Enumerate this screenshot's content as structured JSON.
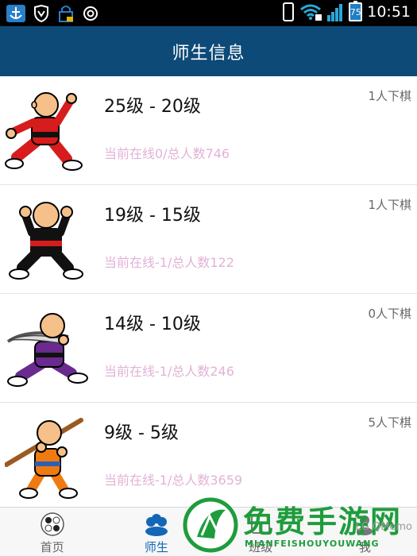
{
  "status_bar": {
    "time": "10:51",
    "battery": "75",
    "icons": [
      "anchor-icon",
      "shield-icon",
      "lock-box-icon",
      "target-icon",
      "phone-icon",
      "wifi-icon",
      "signal-icon",
      "battery-icon"
    ]
  },
  "header": {
    "title": "师生信息"
  },
  "levels": [
    {
      "title": "25级 - 20级",
      "online": "当前在线0/总人数746",
      "playing": "1人下棋",
      "figure": "red"
    },
    {
      "title": "19级 - 15级",
      "online": "当前在线-1/总人数122",
      "playing": "1人下棋",
      "figure": "black"
    },
    {
      "title": "14级 - 10级",
      "online": "当前在线-1/总人数246",
      "playing": "0人下棋",
      "figure": "purple"
    },
    {
      "title": "9级 - 5级",
      "online": "当前在线-1/总人数3659",
      "playing": "5人下棋",
      "figure": "orange"
    }
  ],
  "tabs": [
    {
      "label": "首页",
      "icon": "go-stones-icon"
    },
    {
      "label": "师生",
      "icon": "group-icon",
      "active": true
    },
    {
      "label": "班级",
      "icon": "class-icon"
    },
    {
      "label": "我",
      "icon": "profile-icon"
    }
  ],
  "watermark": {
    "main": "免费手游网",
    "sub": "MIANFEISHOUYOUWANG",
    "badge": "LG QMemo"
  },
  "colors": {
    "header": "#0e4a78",
    "online_text": "#e2b2d6",
    "tab_active": "#1466b7",
    "watermark": "#1e9c3c"
  }
}
